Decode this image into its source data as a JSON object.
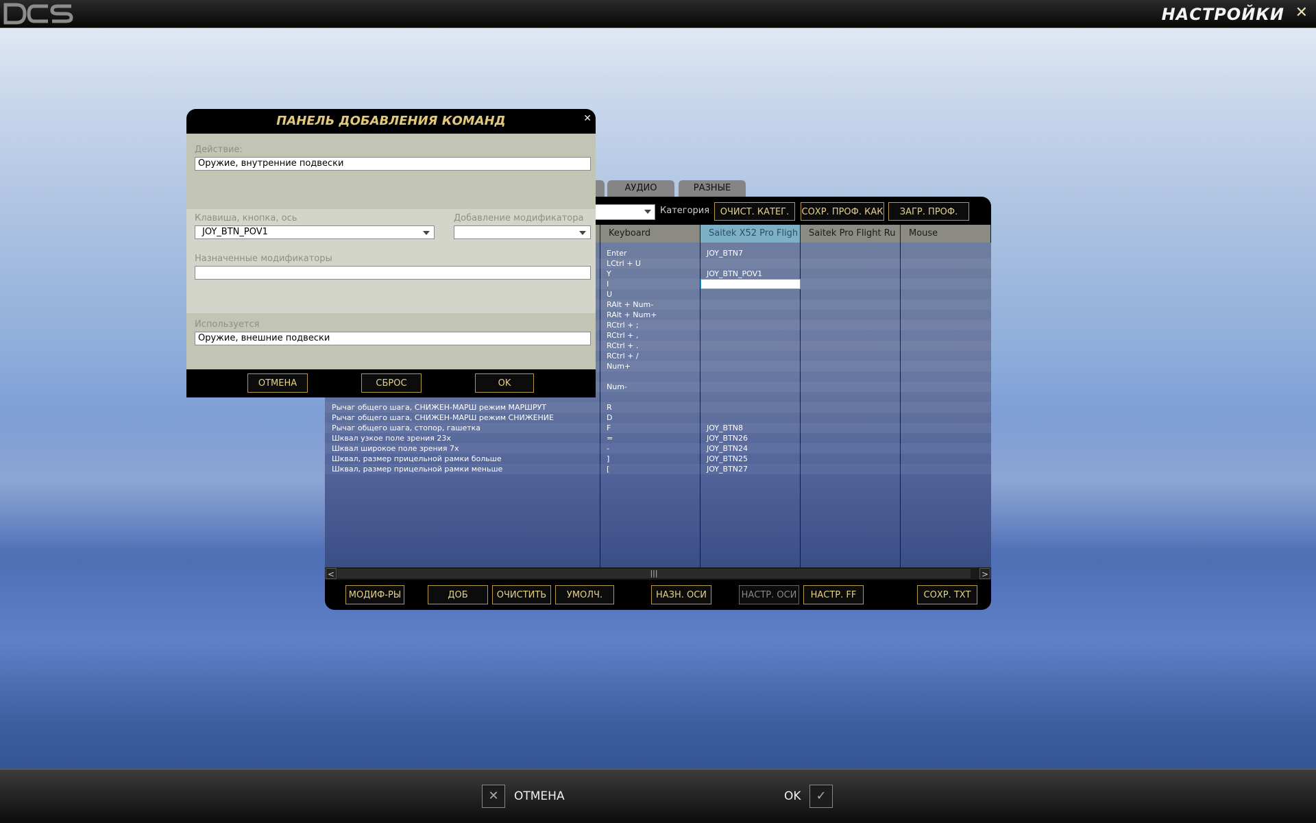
{
  "app": {
    "title": "НАСТРОЙКИ",
    "close": "✕"
  },
  "tabs": [
    {
      "label": ""
    },
    {
      "label": "АУДИО"
    },
    {
      "label": "РАЗНЫЕ"
    }
  ],
  "toolbar": {
    "category_label": "Категория",
    "category_value": "",
    "clear_category": "ОЧИСТ. КАТЕГ.",
    "save_profile": "СОХР. ПРОФ. КАК",
    "load_profile": "ЗАГР. ПРОФ."
  },
  "columns": {
    "keyboard": "Keyboard",
    "x52": "Saitek X52 Pro Fligh",
    "rudder": "Saitek Pro Flight Ru",
    "mouse": "Mouse"
  },
  "rows": [
    {
      "action": "",
      "keyboard": "Enter",
      "x52": "JOY_BTN7"
    },
    {
      "action": "",
      "keyboard": "LCtrl + U",
      "x52": ""
    },
    {
      "action": "",
      "keyboard": "Y",
      "x52": "JOY_BTN_POV1"
    },
    {
      "action": "",
      "keyboard": "I",
      "x52": ""
    },
    {
      "action": "",
      "keyboard": "U",
      "x52": ""
    },
    {
      "action": "",
      "keyboard": "RAlt + Num-",
      "x52": ""
    },
    {
      "action": "",
      "keyboard": "RAlt + Num+",
      "x52": ""
    },
    {
      "action": "",
      "keyboard": "RCtrl + ;",
      "x52": ""
    },
    {
      "action": "",
      "keyboard": "RCtrl + ,",
      "x52": ""
    },
    {
      "action": "",
      "keyboard": "RCtrl + .",
      "x52": ""
    },
    {
      "action": "",
      "keyboard": "RCtrl + /",
      "x52": ""
    },
    {
      "action": "",
      "keyboard": "Num+",
      "x52": ""
    },
    {
      "action": "",
      "keyboard": "",
      "x52": ""
    },
    {
      "action": "",
      "keyboard": "Num-",
      "x52": ""
    },
    {
      "action": "",
      "keyboard": "",
      "x52": ""
    },
    {
      "action": "Рычаг общего шага, СНИЖЕН-МАРШ режим МАРШРУТ",
      "keyboard": "R",
      "x52": ""
    },
    {
      "action": "Рычаг общего шага, СНИЖЕН-МАРШ режим СНИЖЕНИЕ",
      "keyboard": "D",
      "x52": ""
    },
    {
      "action": "Рычаг общего шага, стопор, гашетка",
      "keyboard": "F",
      "x52": "JOY_BTN8"
    },
    {
      "action": "Шквал узкое поле зрения 23x",
      "keyboard": "=",
      "x52": "JOY_BTN26"
    },
    {
      "action": "Шквал широкое поле зрения 7x",
      "keyboard": "-",
      "x52": "JOY_BTN24"
    },
    {
      "action": "Шквал, размер прицельной рамки больше",
      "keyboard": "]",
      "x52": "JOY_BTN25"
    },
    {
      "action": "Шквал, размер прицельной рамки меньше",
      "keyboard": "[",
      "x52": "JOY_BTN27"
    }
  ],
  "bottom_buttons": {
    "modifiers": "МОДИФ-РЫ",
    "add": "ДОБ",
    "clear": "ОЧИСТИТЬ",
    "default": "УМОЛЧ.",
    "assign_axis": "НАЗН. ОСИ",
    "axis_tune": "НАСТР. ОСИ",
    "ff_tune": "НАСТР. FF",
    "save_txt": "СОХР. TXT"
  },
  "dialog": {
    "title": "ПАНЕЛЬ ДОБАВЛЕНИЯ КОМАНД",
    "action_label": "Действие:",
    "action_value": "Оружие, внутренние подвески",
    "key_label": "Клавиша, кнопка, ось",
    "key_value": "JOY_BTN_POV1",
    "modifier_label": "Добавление модификатора",
    "modifier_value": "",
    "assigned_label": "Назначенные модификаторы",
    "assigned_value": "",
    "used_label": "Используется",
    "used_value": "Оружие, внешние подвески",
    "cancel": "ОТМЕНА",
    "reset": "СБРОС",
    "ok": "OK"
  },
  "footer": {
    "cancel": "ОТМЕНА",
    "ok": "OK"
  }
}
